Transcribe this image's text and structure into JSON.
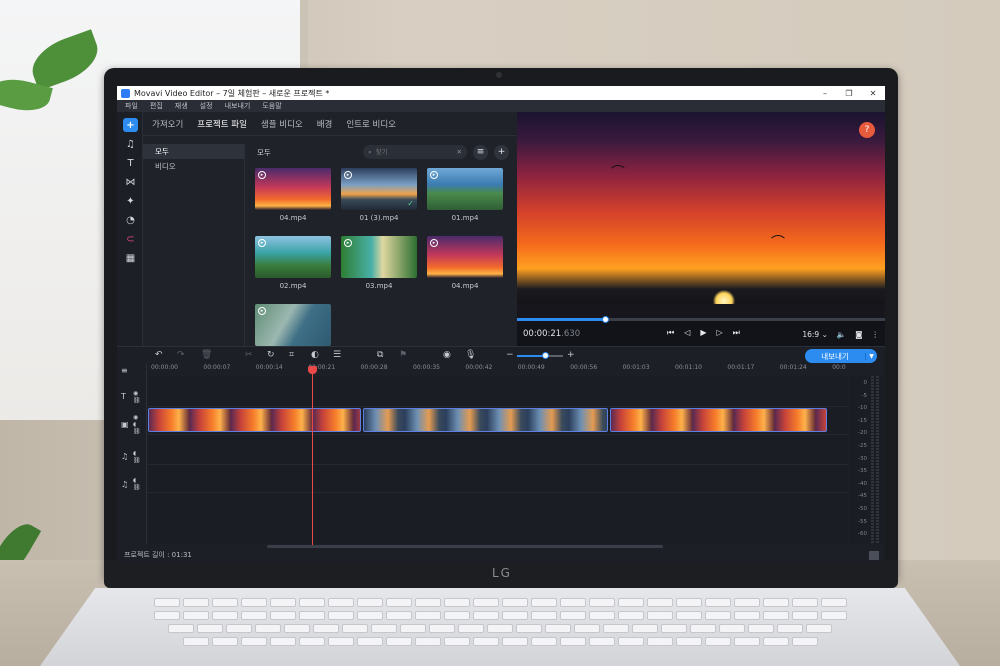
{
  "window": {
    "title": "Movavi Video Editor – 7일 체험판 – 새로운 프로젝트 *",
    "controls": [
      "–",
      "❐",
      "✕"
    ]
  },
  "menu": [
    "파일",
    "편집",
    "재생",
    "설정",
    "내보내기",
    "도움말"
  ],
  "left_toolbar": {
    "add_icon": "plus-icon",
    "tools": [
      "music-icon",
      "text-icon",
      "transitions-icon",
      "effects-icon",
      "sticker-icon",
      "magnet-icon",
      "more-tools-icon"
    ]
  },
  "import_tabs": [
    "가져오기",
    "프로젝트 파일",
    "샘플 비디오",
    "배경",
    "인트로 비디오"
  ],
  "active_import_tab": "프로젝트 파일",
  "categories": [
    "모두",
    "비디오"
  ],
  "selected_category": "모두",
  "media_header": "모두",
  "search": {
    "placeholder": "찾기",
    "value": ""
  },
  "media_files": [
    {
      "name": "04.mp4",
      "style": "sunset",
      "added": false
    },
    {
      "name": "01 (3).mp4",
      "style": "dawn",
      "added": true
    },
    {
      "name": "01.mp4",
      "style": "coast",
      "added": false
    },
    {
      "name": "02.mp4",
      "style": "river",
      "added": false
    },
    {
      "name": "03.mp4",
      "style": "lagoon",
      "added": false
    },
    {
      "name": "04.mp4",
      "style": "sunset",
      "added": false
    },
    {
      "name": "",
      "style": "road",
      "added": false
    }
  ],
  "preview": {
    "timecode": "00:00:21",
    "timecode_ms": ".630",
    "progress": 0.24,
    "aspect": "16:9 ⌄",
    "help": "?"
  },
  "timeline": {
    "zoom_level": 0.6,
    "export_label": "내보내기",
    "ruler": [
      "00:00:00",
      "00:00:07",
      "00:00:14",
      "00:00:21",
      "00:00:28",
      "00:00:35",
      "00:00:42",
      "00:00:49",
      "00:00:56",
      "00:01:03",
      "00:01:10",
      "00:01:17",
      "00:01:24",
      "00:0"
    ],
    "clips": [
      {
        "name": "sunset-clip",
        "style": "sunset",
        "start": 0,
        "end": 0.31
      },
      {
        "name": "dawn-clip",
        "style": "dawn",
        "start": 0.313,
        "end": 0.67
      },
      {
        "name": "sunset-clip-2",
        "style": "sunset",
        "start": 0.673,
        "end": 0.99
      }
    ],
    "vu_scale": [
      "0",
      "-5",
      "-10",
      "-15",
      "-20",
      "-25",
      "-30",
      "-35",
      "-40",
      "-45",
      "-50",
      "-55",
      "-60"
    ]
  },
  "status": {
    "project_length": "프로젝트 길이 : 01:31"
  },
  "laptop_brand": "LG"
}
